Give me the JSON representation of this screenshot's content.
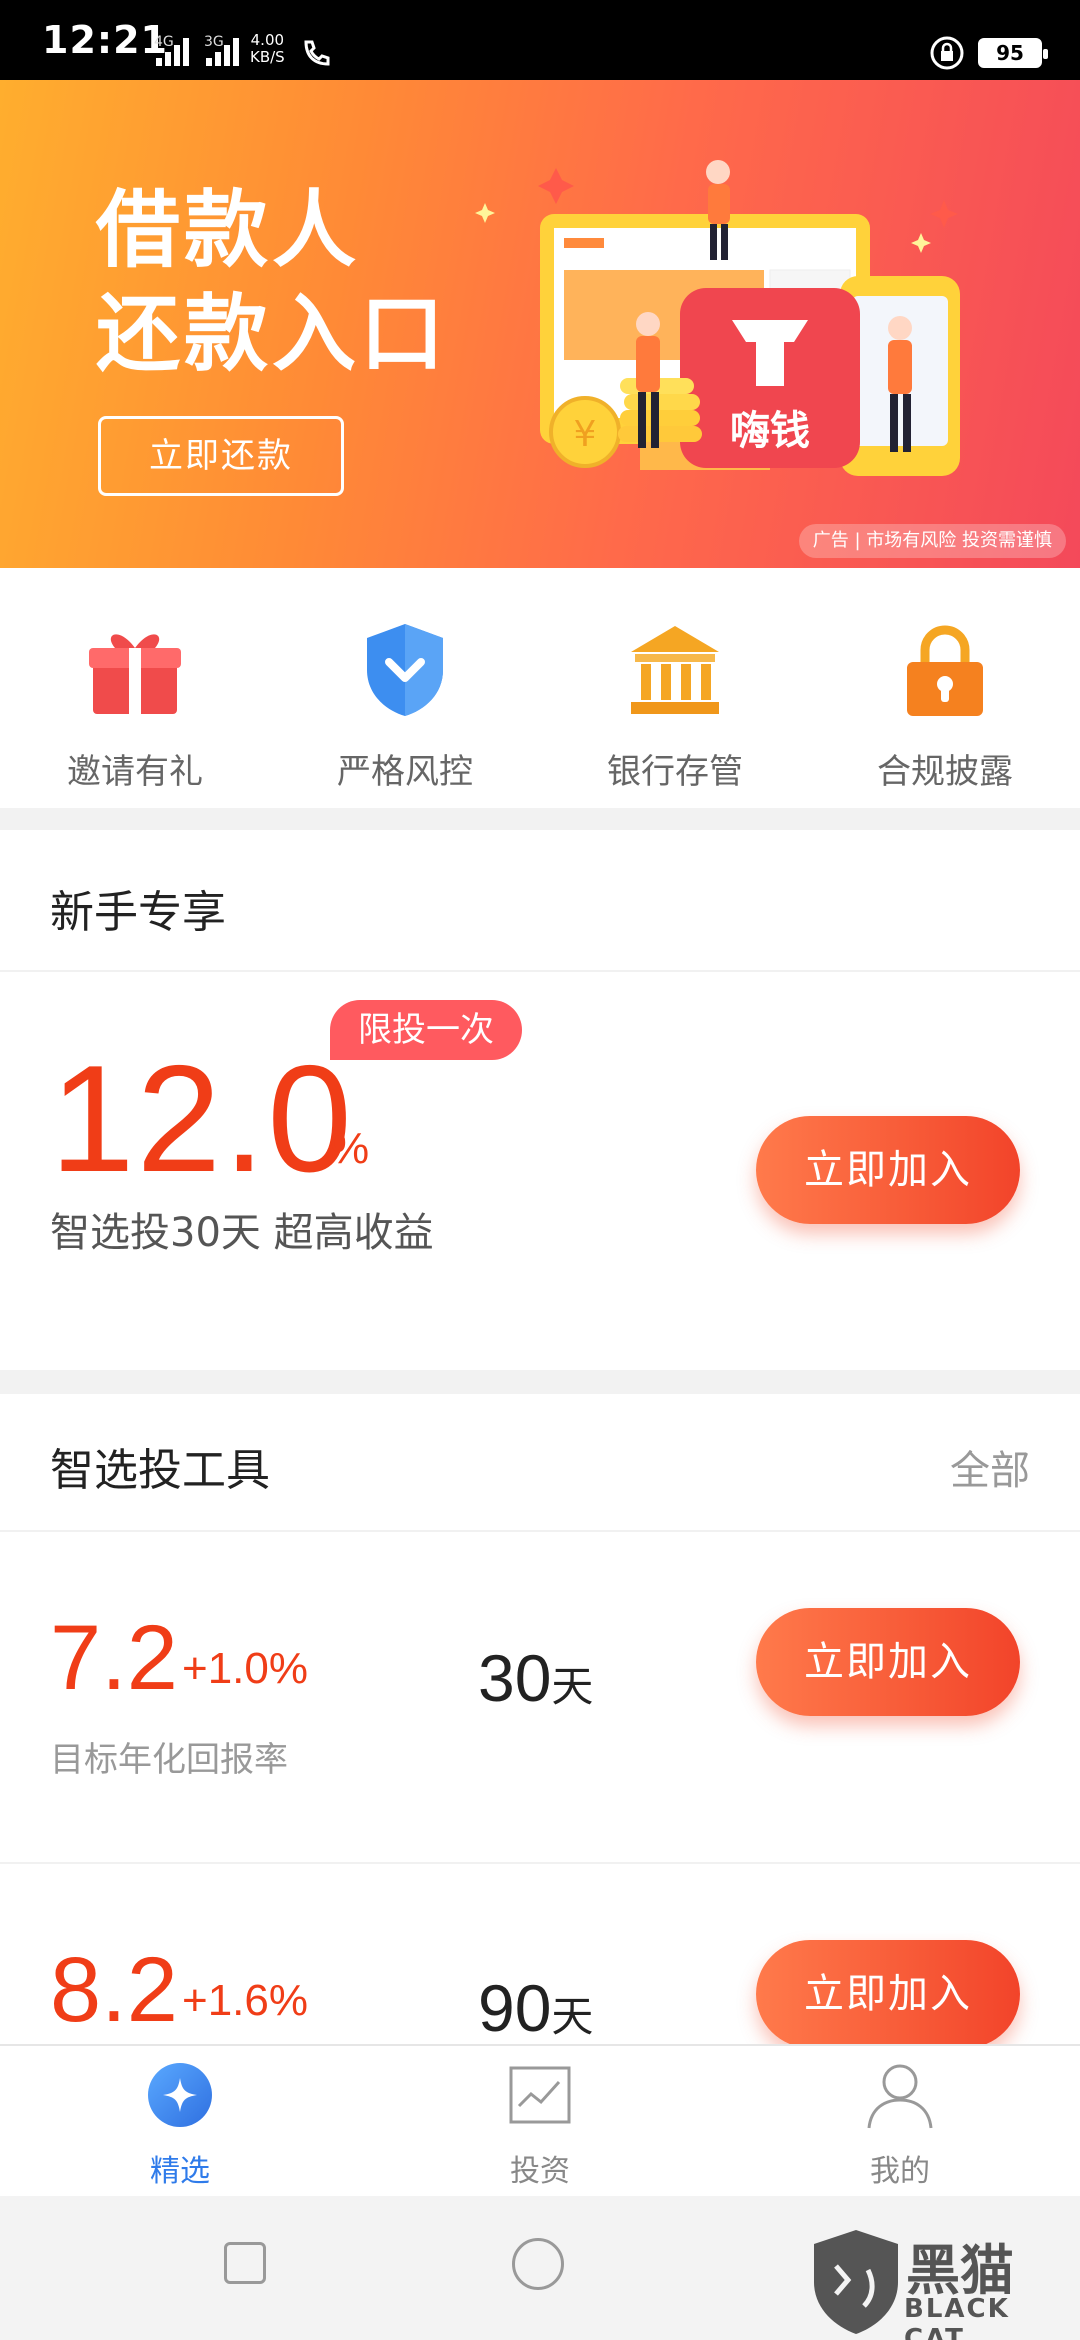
{
  "status_bar": {
    "time": "12:21",
    "network_1": "4G",
    "network_2": "3G",
    "net_speed_value": "4.00",
    "net_speed_unit": "KB/S",
    "battery": "95"
  },
  "banner": {
    "title_line1": "借款人",
    "title_line2": "还款入口",
    "button_label": "立即还款",
    "app_logo_text": "嗨钱",
    "disclaimer": "广告 | 市场有风险 投资需谨慎"
  },
  "quick_menu": [
    {
      "label": "邀请有礼",
      "icon": "gift-icon",
      "color": "#f04b4b"
    },
    {
      "label": "严格风控",
      "icon": "shield-check-icon",
      "color": "#3d8ef0"
    },
    {
      "label": "银行存管",
      "icon": "bank-icon",
      "color": "#f5a623"
    },
    {
      "label": "合规披露",
      "icon": "lock-icon",
      "color": "#f5811f"
    }
  ],
  "newbie": {
    "section_title": "新手专享",
    "rate": "12.0",
    "rate_unit": "%",
    "tag": "限投一次",
    "subtitle": "智选投30天 超高收益",
    "button_label": "立即加入"
  },
  "tools": {
    "section_title": "智选投工具",
    "more_label": "全部",
    "products": [
      {
        "rate": "7.2",
        "extra": "+1.0%",
        "label": "目标年化回报率",
        "days": "30",
        "days_unit": "天",
        "button_label": "立即加入"
      },
      {
        "rate": "8.2",
        "extra": "+1.6%",
        "days": "90",
        "days_unit": "天",
        "button_label": "立即加入"
      }
    ]
  },
  "tabbar": {
    "items": [
      {
        "label": "精选",
        "icon": "sparkle-icon",
        "active": true
      },
      {
        "label": "投资",
        "icon": "chart-icon",
        "active": false
      },
      {
        "label": "我的",
        "icon": "user-icon",
        "active": false
      }
    ]
  },
  "watermark": {
    "text": "黑猫",
    "sub": "BLACK CAT"
  },
  "colors": {
    "accent_red": "#f03d17",
    "button_gradient_start": "#ff7a4b",
    "button_gradient_end": "#f2442a",
    "tab_active": "#2f7bea"
  }
}
